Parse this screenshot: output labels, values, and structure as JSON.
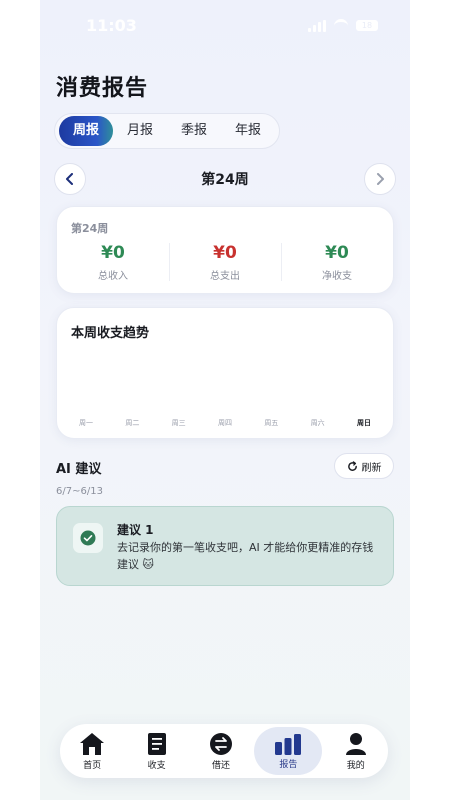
{
  "status": {
    "time": "11:03",
    "battery": "18"
  },
  "page": {
    "title": "消费报告"
  },
  "period_tabs": [
    {
      "label": "周报",
      "active": true
    },
    {
      "label": "月报",
      "active": false
    },
    {
      "label": "季报",
      "active": false
    },
    {
      "label": "年报",
      "active": false
    }
  ],
  "week_nav": {
    "label": "第24周"
  },
  "summary": {
    "week": "第24周",
    "income": {
      "amount": "¥0",
      "label": "总收入",
      "color": "#2e8a55"
    },
    "expense": {
      "amount": "¥0",
      "label": "总支出",
      "color": "#c8322f"
    },
    "net": {
      "amount": "¥0",
      "label": "净收支",
      "color": "#2e8a55"
    }
  },
  "trend": {
    "title": "本周收支趋势",
    "days": [
      "周一",
      "周二",
      "周三",
      "周四",
      "周五",
      "周六",
      "周日"
    ],
    "current_day_index": 6
  },
  "ai": {
    "title": "AI 建议",
    "refresh_label": "刷新",
    "range": "6/7~6/13",
    "suggestion": {
      "title": "建议 1",
      "text": "去记录你的第一笔收支吧，AI 才能给你更精准的存钱建议 🐱"
    }
  },
  "tabbar": [
    {
      "label": "首页",
      "icon": "home-icon",
      "active": false
    },
    {
      "label": "收支",
      "icon": "ledger-icon",
      "active": false
    },
    {
      "label": "借还",
      "icon": "exchange-icon",
      "active": false
    },
    {
      "label": "报告",
      "icon": "bar-chart-icon",
      "active": true
    },
    {
      "label": "我的",
      "icon": "user-icon",
      "active": false
    }
  ],
  "colors": {
    "accent": "#1d3aa0",
    "income": "#2e8a55",
    "expense": "#c8322f",
    "suggestion_bg": "#d5e6e3"
  }
}
